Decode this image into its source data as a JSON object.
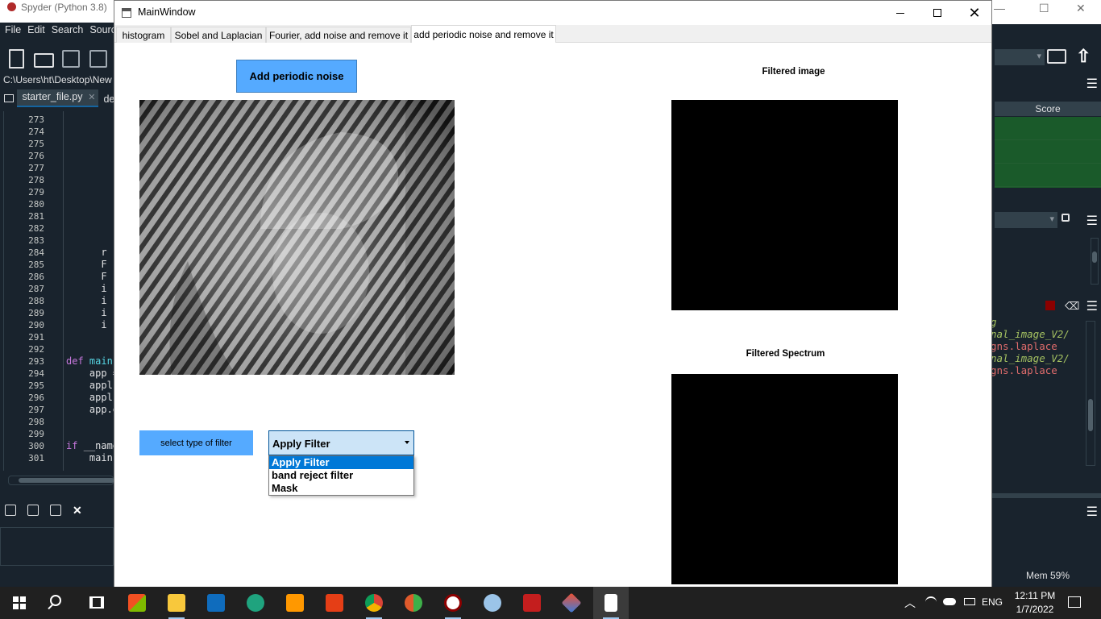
{
  "spyder": {
    "window_title": "Spyder (Python 3.8)",
    "menu": [
      "File",
      "Edit",
      "Search",
      "Source"
    ],
    "path": "C:\\Users\\ht\\Desktop\\New fo",
    "editor_tab_active": "starter_file.py",
    "editor_tab_other": "de",
    "line_numbers": [
      "273",
      "274",
      "275",
      "276",
      "277",
      "278",
      "279",
      "280",
      "281",
      "282",
      "283",
      "284",
      "285",
      "286",
      "287",
      "288",
      "289",
      "290",
      "291",
      "292",
      "293",
      "294",
      "295",
      "296",
      "297",
      "298",
      "299",
      "300",
      "301"
    ],
    "code_lines": [
      "",
      "",
      "",
      "",
      "",
      "",
      "",
      "",
      "",
      "",
      "",
      "      r",
      "      F",
      "      F",
      "      i",
      "      i",
      "      i",
      "      i",
      "",
      "",
      "def main",
      "    app =",
      "    appl",
      "    appl",
      "    app.e",
      "",
      "",
      "if __name",
      "    main"
    ],
    "right_panel": {
      "score_header": "Score",
      "console_lines": [
        "g",
        "nal_image_V2/",
        "",
        "",
        "gns.laplace",
        "",
        "nal_image_V2/",
        "",
        "",
        "gns.laplace"
      ],
      "memory": "Mem 59%"
    },
    "accent_colors": {
      "background": "#19232d",
      "score_green": "#1a5a2a"
    }
  },
  "main_window": {
    "title": "MainWindow",
    "tabs": [
      {
        "label": "histogram",
        "active": false
      },
      {
        "label": "Sobel and Laplacian",
        "active": false
      },
      {
        "label": "Fourier, add noise and remove it",
        "active": false
      },
      {
        "label": "add periodic noise and remove it",
        "active": true
      }
    ],
    "add_noise_button": "Add periodic noise",
    "filtered_image_title": "Filtered image",
    "filtered_spectrum_title": "Filtered Spectrum",
    "filter_type_label": "select type of filter",
    "filter_combo": {
      "selected": "Apply Filter",
      "options": [
        "Apply Filter",
        "band reject filter",
        "Mask"
      ],
      "highlighted_index": 0
    },
    "accent_colors": {
      "button_blue": "#55aaff",
      "combo_highlight": "#0078d7"
    }
  },
  "taskbar": {
    "apps": [
      "start-icon",
      "search-icon",
      "task-view-icon",
      "microsoft-store-icon",
      "file-explorer-icon",
      "mail-icon",
      "edge-icon",
      "sublime-text-icon",
      "office-icon",
      "chrome-icon",
      "anaconda-icon",
      "spyder-icon",
      "paint-icon",
      "app-red-icon",
      "git-icon",
      "notepad-icon"
    ],
    "language": "ENG",
    "time": "12:11 PM",
    "date": "1/7/2022"
  }
}
